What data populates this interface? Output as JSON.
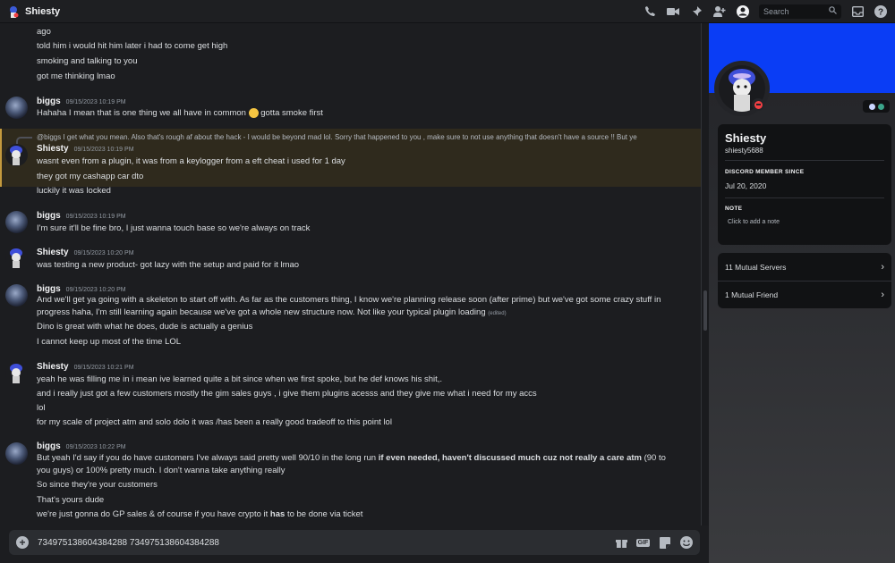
{
  "header": {
    "title": "Shiesty",
    "search_placeholder": "Search"
  },
  "messages": {
    "prev_lines": [
      "ago",
      "told him i would hit him later i had to come get high",
      "smoking and talking to you",
      "got me thinking lmao"
    ],
    "m1": {
      "author": "biggs",
      "time": "09/15/2023 10:19 PM",
      "text_before": "Hahaha I mean that is one thing we all have in common",
      "text_after": "gotta smoke first"
    },
    "reply_preview": "@biggs I get what you mean. Also that's rough af about the hack - I would be beyond mad lol. Sorry that happened to you , make sure to not use anything that doesn't have a source !! But ye",
    "m2": {
      "author": "Shiesty",
      "time": "09/15/2023 10:19 PM",
      "lines": [
        "wasnt even from a plugin, it was from a keylogger from a eft cheat i used for 1 day",
        "they got my cashapp car dto",
        "luckily it was locked"
      ]
    },
    "m3": {
      "author": "biggs",
      "time": "09/15/2023 10:19 PM",
      "lines": [
        "I'm sure it'll be fine bro, I just wanna touch base so we're always on track"
      ]
    },
    "m4": {
      "author": "Shiesty",
      "time": "09/15/2023 10:20 PM",
      "lines": [
        "was testing a new product- got lazy with the setup and paid for it lmao"
      ]
    },
    "m5": {
      "author": "biggs",
      "time": "09/15/2023 10:20 PM",
      "para": "And we'll get ya going with a skeleton to start off with. As far as the customers thing, I know we're planning release soon (after prime) but we've got some crazy stuff in progress haha, I'm still learning again because we've got a whole new structure now. Not like your typical plugin loading",
      "edited": "(edited)",
      "lines": [
        "Dino is great with what he does, dude is actually a genius",
        "I cannot keep up most of the time LOL"
      ]
    },
    "m6": {
      "author": "Shiesty",
      "time": "09/15/2023 10:21 PM",
      "lines": [
        "yeah he was filling me in i mean ive learned quite a bit since when we first spoke, but he def knows his shit,.",
        "and i really just got a few customers mostly the gim sales guys , i give them plugins acesss and they give me what i need for my accs",
        "lol",
        "for my scale of project atm and solo dolo it was /has been a really good tradeoff to this point lol"
      ]
    },
    "m7": {
      "author": "biggs",
      "time": "09/15/2023 10:22 PM",
      "para_a": "But yeah I'd say if you do have customers I've always said pretty well 90/10 in the long run",
      "para_bold": "if even needed, haven't discussed much cuz not really a care atm",
      "para_b": "(90 to you guys) or 100% pretty much. I don't wanna take anything really",
      "lines": [
        "So since they're your customers",
        "That's yours dude"
      ],
      "last_a": "we're just gonna do GP sales & of course if you have crypto it",
      "last_bold": "has",
      "last_b": "to be done via ticket"
    }
  },
  "composer": {
    "value": "734975138604384288 734975138604384288",
    "gif_label": "GIF"
  },
  "profile": {
    "display_name": "Shiesty",
    "username": "shiesty5688",
    "member_since_label": "DISCORD MEMBER SINCE",
    "member_since": "Jul 20, 2020",
    "note_label": "NOTE",
    "note_placeholder": "Click to add a note",
    "mutual_servers": "11 Mutual Servers",
    "mutual_friends": "1 Mutual Friend"
  },
  "colors": {
    "banner": "#0a3df5",
    "dnd": "#f23f43",
    "reply_highlight": "#2f2a1d"
  }
}
